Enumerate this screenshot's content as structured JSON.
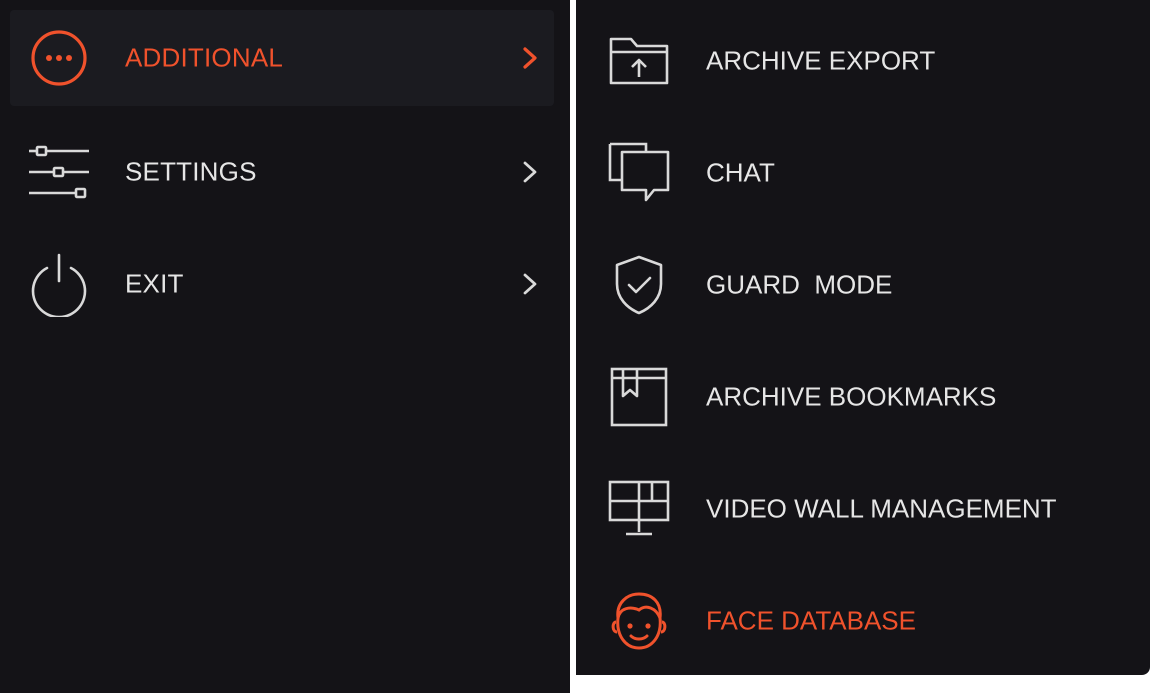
{
  "colors": {
    "background": "#141317",
    "accent": "#f0522c",
    "text": "#e6e6e6",
    "icon": "#d9d9d9"
  },
  "main_menu": {
    "items": [
      {
        "label": "ADDITIONAL",
        "icon": "more-horizontal-circle-icon",
        "active": true
      },
      {
        "label": "SETTINGS",
        "icon": "sliders-icon",
        "active": false
      },
      {
        "label": "EXIT",
        "icon": "power-icon",
        "active": false
      }
    ]
  },
  "submenu": {
    "items": [
      {
        "label": "ARCHIVE EXPORT",
        "icon": "folder-upload-icon"
      },
      {
        "label": "CHAT",
        "icon": "chat-icon"
      },
      {
        "label": "GUARD  MODE",
        "icon": "shield-check-icon"
      },
      {
        "label": "ARCHIVE BOOKMARKS",
        "icon": "bookmark-box-icon"
      },
      {
        "label": "VIDEO WALL MANAGEMENT",
        "icon": "monitor-grid-icon"
      },
      {
        "label": "FACE DATABASE",
        "icon": "face-icon",
        "accent": true
      }
    ]
  }
}
